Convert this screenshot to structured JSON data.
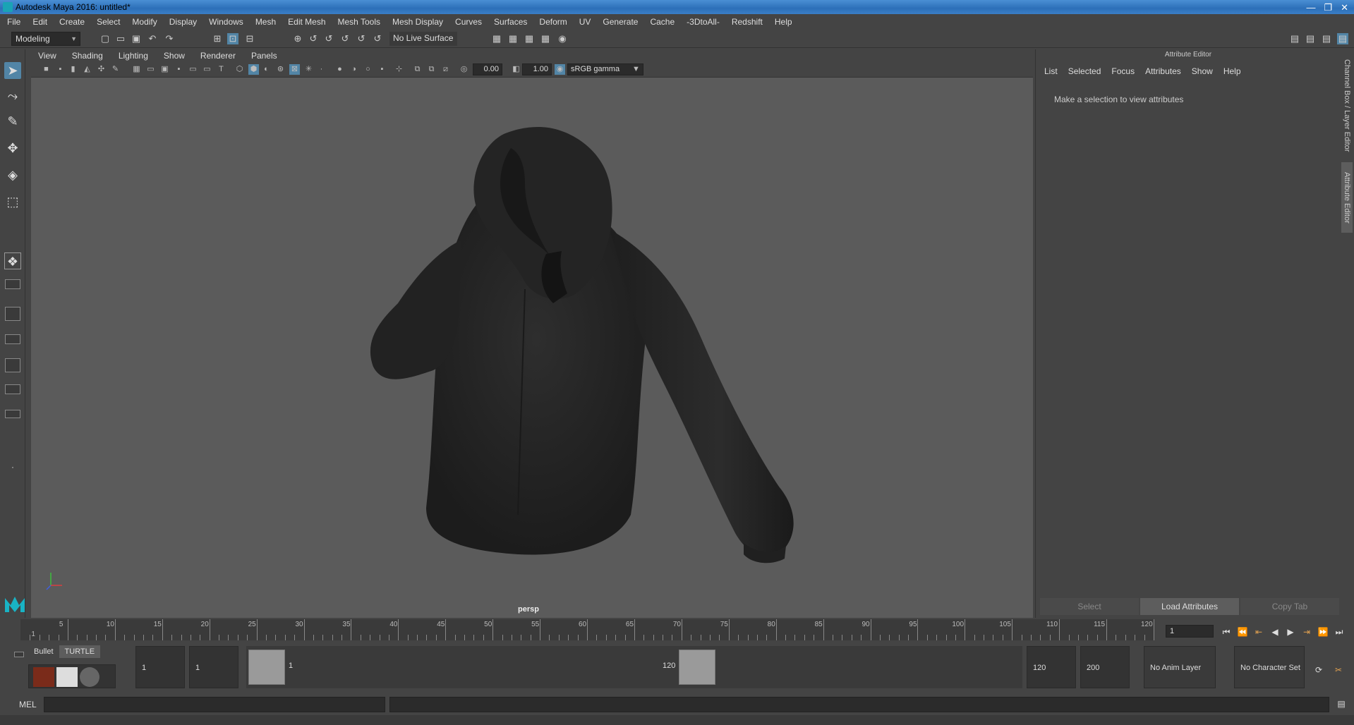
{
  "window": {
    "title": "Autodesk Maya 2016: untitled*",
    "buttons": [
      "—",
      "❐",
      "✕"
    ]
  },
  "menubar": [
    "File",
    "Edit",
    "Create",
    "Select",
    "Modify",
    "Display",
    "Windows",
    "Mesh",
    "Edit Mesh",
    "Mesh Tools",
    "Mesh Display",
    "Curves",
    "Surfaces",
    "Deform",
    "UV",
    "Generate",
    "Cache",
    "-3DtoAll-",
    "Redshift",
    "Help"
  ],
  "statusline": {
    "mode": "Modeling",
    "live_surface": "No Live Surface"
  },
  "viewport": {
    "menu": [
      "View",
      "Shading",
      "Lighting",
      "Show",
      "Renderer",
      "Panels"
    ],
    "exposure": "0.00",
    "gamma": "1.00",
    "colorspace": "sRGB gamma",
    "camera_label": "persp"
  },
  "attribute_editor": {
    "title": "Attribute Editor",
    "menu": [
      "List",
      "Selected",
      "Focus",
      "Attributes",
      "Show",
      "Help"
    ],
    "message": "Make a selection to view attributes",
    "buttons": {
      "select": "Select",
      "load": "Load Attributes",
      "copy": "Copy Tab"
    }
  },
  "side_tabs": {
    "channel_box": "Channel Box / Layer Editor",
    "attribute_editor": "Attribute Editor"
  },
  "timeline": {
    "ticks": [
      "1",
      "5",
      "10",
      "15",
      "20",
      "25",
      "30",
      "35",
      "40",
      "45",
      "50",
      "55",
      "60",
      "65",
      "70",
      "75",
      "80",
      "85",
      "90",
      "95",
      "100",
      "105",
      "110",
      "115",
      "120"
    ],
    "current_frame": "1"
  },
  "range": {
    "start": "1",
    "playback_start": "1",
    "handle_start_label": "1",
    "handle_end_label": "120",
    "playback_end": "120",
    "end": "200",
    "anim_layer": "No Anim Layer",
    "character_set": "No Character Set"
  },
  "shelf_tabs": [
    "Bullet",
    "TURTLE"
  ],
  "command_line": {
    "label": "MEL"
  },
  "colors": {
    "accent": "#5285a6",
    "panel": "#444444",
    "viewport_bg": "#5b5b5b",
    "model": "#262626"
  }
}
